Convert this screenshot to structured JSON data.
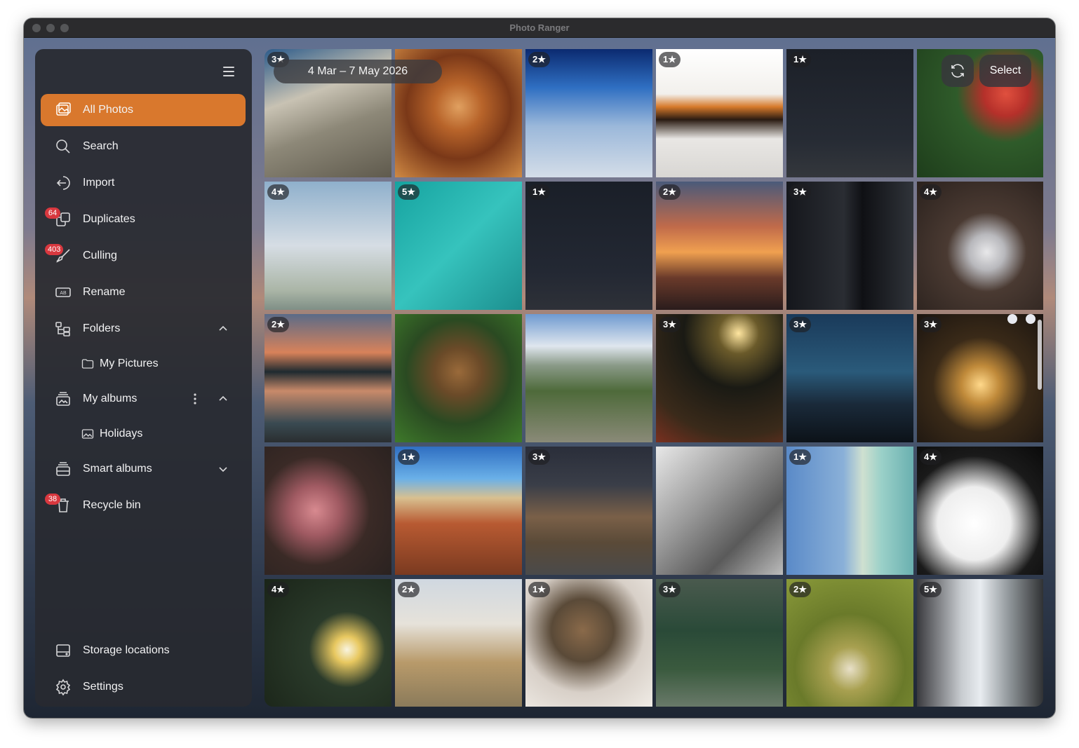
{
  "window": {
    "title": "Photo Ranger"
  },
  "sidebar": {
    "items": [
      {
        "label": "All Photos",
        "icon": "photos-icon"
      },
      {
        "label": "Search",
        "icon": "search-icon"
      },
      {
        "label": "Import",
        "icon": "import-icon"
      },
      {
        "label": "Duplicates",
        "icon": "duplicates-icon",
        "badge": "64"
      },
      {
        "label": "Culling",
        "icon": "culling-icon",
        "badge": "403"
      },
      {
        "label": "Rename",
        "icon": "rename-icon"
      },
      {
        "label": "Folders",
        "icon": "folders-icon"
      },
      {
        "label": "My Pictures",
        "icon": "folder-icon"
      },
      {
        "label": "My albums",
        "icon": "albums-icon"
      },
      {
        "label": "Holidays",
        "icon": "album-icon"
      },
      {
        "label": "Smart albums",
        "icon": "smart-albums-icon"
      },
      {
        "label": "Recycle bin",
        "icon": "recycle-bin-icon",
        "badge": "38"
      },
      {
        "label": "Storage locations",
        "icon": "storage-icon"
      },
      {
        "label": "Settings",
        "icon": "settings-icon"
      }
    ]
  },
  "header": {
    "date_range": "4 Mar – 7 May 2026",
    "select_label": "Select"
  },
  "photos": [
    {
      "rating": "3★"
    },
    {
      "rating": ""
    },
    {
      "rating": "2★"
    },
    {
      "rating": "1★"
    },
    {
      "rating": "1★"
    },
    {
      "rating": ""
    },
    {
      "rating": "4★"
    },
    {
      "rating": "5★"
    },
    {
      "rating": "1★"
    },
    {
      "rating": "2★"
    },
    {
      "rating": "3★"
    },
    {
      "rating": "4★"
    },
    {
      "rating": "2★"
    },
    {
      "rating": ""
    },
    {
      "rating": ""
    },
    {
      "rating": "3★"
    },
    {
      "rating": "3★"
    },
    {
      "rating": "3★"
    },
    {
      "rating": ""
    },
    {
      "rating": "1★"
    },
    {
      "rating": "3★"
    },
    {
      "rating": ""
    },
    {
      "rating": "1★"
    },
    {
      "rating": "4★"
    },
    {
      "rating": "4★"
    },
    {
      "rating": "2★"
    },
    {
      "rating": "1★"
    },
    {
      "rating": "3★"
    },
    {
      "rating": "2★"
    },
    {
      "rating": "5★"
    }
  ],
  "colors": {
    "accent": "#d9782d",
    "badge": "#d8383f"
  }
}
